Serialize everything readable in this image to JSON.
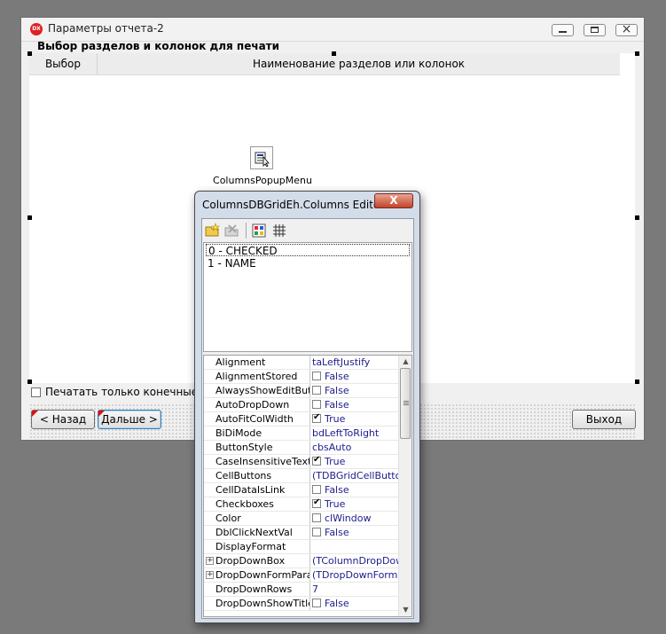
{
  "form": {
    "title": "Параметры отчета-2",
    "icon": "dx-app-icon",
    "section_label": "Выбор разделов и колонок для печати",
    "grid_headers": [
      "Выбор",
      "Наименование разделов или колонок"
    ],
    "popup_component_caption": "ColumnsPopupMenu",
    "checkbox_label": "Печатать только конечные во",
    "checkbox_checked": false,
    "buttons": {
      "back": "< Назад",
      "next": "Дальше >",
      "exit": "Выход"
    }
  },
  "editor": {
    "title": "ColumnsDBGridEh.Columns Editor",
    "close_label": "X",
    "toolbar_icons": [
      "add-icon",
      "delete-icon",
      "add-all-fields-icon",
      "grid-icon"
    ],
    "columns": [
      "0 - CHECKED",
      "1 - NAME"
    ],
    "selected_column": 0,
    "properties": [
      {
        "name": "Alignment",
        "value": "taLeftJustify"
      },
      {
        "name": "AlignmentStored",
        "value": "False",
        "check": false
      },
      {
        "name": "AlwaysShowEditButton",
        "value": "False",
        "check": false
      },
      {
        "name": "AutoDropDown",
        "value": "False",
        "check": false
      },
      {
        "name": "AutoFitColWidth",
        "value": "True",
        "check": true
      },
      {
        "name": "BiDiMode",
        "value": "bdLeftToRight"
      },
      {
        "name": "ButtonStyle",
        "value": "cbsAuto"
      },
      {
        "name": "CaseInsensitiveTextSearch",
        "value": "True",
        "check": true
      },
      {
        "name": "CellButtons",
        "value": "(TDBGridCellButtons)"
      },
      {
        "name": "CellDataIsLink",
        "value": "False",
        "check": false
      },
      {
        "name": "Checkboxes",
        "value": "True",
        "check": true
      },
      {
        "name": "Color",
        "value": "clWindow",
        "check": false
      },
      {
        "name": "DblClickNextVal",
        "value": "False",
        "check": false
      },
      {
        "name": "DisplayFormat",
        "value": ""
      },
      {
        "name": "DropDownBox",
        "value": "(TColumnDropDownBox)",
        "expand": true
      },
      {
        "name": "DropDownFormParams",
        "value": "(TDropDownFormCallParams)",
        "expand": true
      },
      {
        "name": "DropDownRows",
        "value": "7"
      },
      {
        "name": "DropDownShowTitles",
        "value": "False",
        "check": false
      }
    ]
  }
}
